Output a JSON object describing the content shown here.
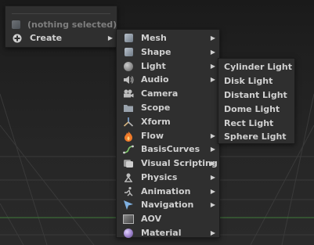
{
  "root_menu": {
    "nothing_selected": "(nothing selected)",
    "create_label": "Create"
  },
  "create_menu": {
    "items": [
      {
        "label": "Mesh",
        "icon": "mesh-icon",
        "has_submenu": true
      },
      {
        "label": "Shape",
        "icon": "shape-icon",
        "has_submenu": true
      },
      {
        "label": "Light",
        "icon": "light-icon",
        "has_submenu": true
      },
      {
        "label": "Audio",
        "icon": "audio-icon",
        "has_submenu": true
      },
      {
        "label": "Camera",
        "icon": "camera-icon",
        "has_submenu": false
      },
      {
        "label": "Scope",
        "icon": "scope-icon",
        "has_submenu": false
      },
      {
        "label": "Xform",
        "icon": "xform-icon",
        "has_submenu": false
      },
      {
        "label": "Flow",
        "icon": "flow-icon",
        "has_submenu": true
      },
      {
        "label": "BasisCurves",
        "icon": "basis-curves-icon",
        "has_submenu": true
      },
      {
        "label": "Visual Scripting",
        "icon": "visual-scripting-icon",
        "has_submenu": true
      },
      {
        "label": "Physics",
        "icon": "physics-icon",
        "has_submenu": true
      },
      {
        "label": "Animation",
        "icon": "animation-icon",
        "has_submenu": true
      },
      {
        "label": "Navigation",
        "icon": "navigation-icon",
        "has_submenu": true
      },
      {
        "label": "AOV",
        "icon": "aov-icon",
        "has_submenu": false
      },
      {
        "label": "Material",
        "icon": "material-icon",
        "has_submenu": true
      }
    ]
  },
  "light_menu": {
    "items": [
      "Cylinder Light",
      "Disk Light",
      "Distant Light",
      "Dome Light",
      "Rect Light",
      "Sphere Light"
    ]
  },
  "colors": {
    "menu_bg": "#2f2f2f",
    "text": "#d0d0d0",
    "disabled_text": "#7e7e7e",
    "viewport_bg": "#1f1f1f",
    "grid_accent": "#3f7a3a"
  }
}
